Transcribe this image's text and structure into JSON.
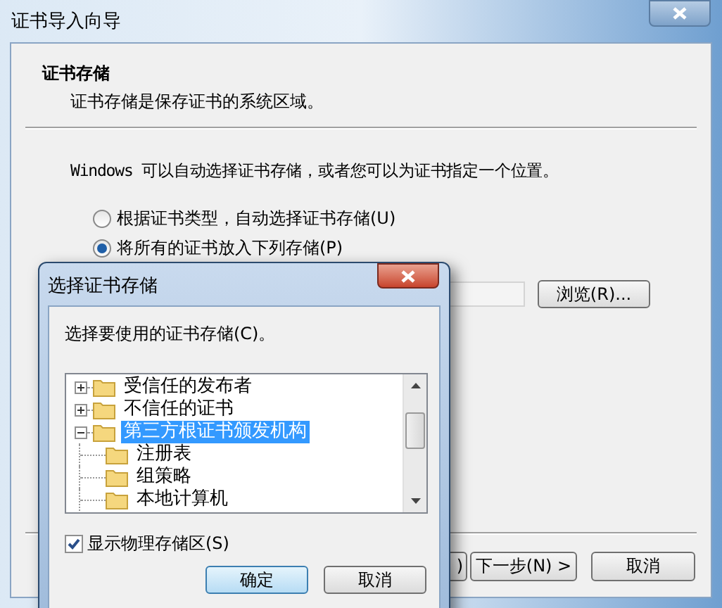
{
  "window": {
    "title": "证书导入向导"
  },
  "header": {
    "title": "证书存储",
    "subtitle": "证书存储是保存证书的系统区域。"
  },
  "intro": "Windows 可以自动选择证书存储，或者您可以为证书指定一个位置。",
  "options": [
    {
      "label": "根据证书类型，自动选择证书存储(U)",
      "selected": false
    },
    {
      "label": "将所有的证书放入下列存储(P)",
      "selected": true
    }
  ],
  "browse_button": "浏览(R)...",
  "footer_buttons": [
    ")",
    "下一步(N) >",
    "取消"
  ],
  "dialog": {
    "title": "选择证书存储",
    "prompt": "选择要使用的证书存储(C)。",
    "tree": [
      {
        "label": "受信任的发布者",
        "expanded": false,
        "selected": false
      },
      {
        "label": "不信任的证书",
        "expanded": false,
        "selected": false
      },
      {
        "label": "第三方根证书颁发机构",
        "expanded": true,
        "selected": true,
        "children": [
          {
            "label": "注册表",
            "selected": false
          },
          {
            "label": "组策略",
            "selected": false
          },
          {
            "label": "本地计算机",
            "selected": false
          }
        ]
      }
    ],
    "show_physical": {
      "label": "显示物理存储区(S)",
      "checked": true
    },
    "buttons": [
      "确定",
      "取消"
    ]
  }
}
